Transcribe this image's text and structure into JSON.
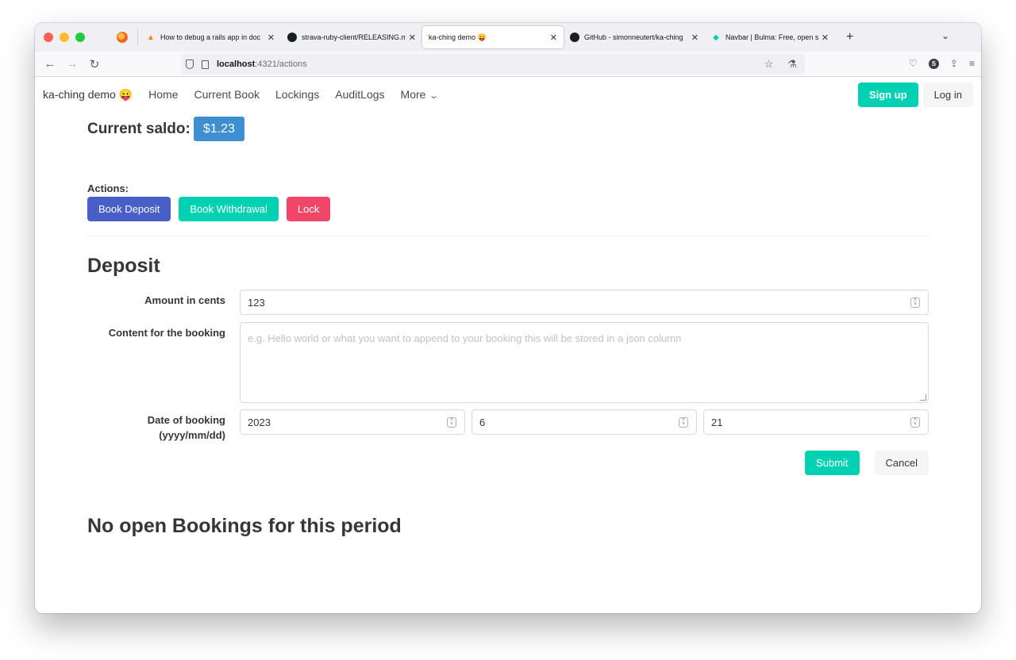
{
  "browser": {
    "tabs": [
      {
        "label": "How to debug a rails app in doc",
        "icon": "stackoverflow-icon"
      },
      {
        "label": "strava-ruby-client/RELEASING.m",
        "icon": "github-icon"
      },
      {
        "label": "ka-ching demo 😛",
        "icon": "",
        "active": true
      },
      {
        "label": "GitHub - simonneutert/ka-ching",
        "icon": "github-icon"
      },
      {
        "label": "Navbar | Bulma: Free, open sour",
        "icon": "bulma-icon"
      }
    ],
    "url_host": "localhost",
    "url_rest": ":4321/actions"
  },
  "site_nav": {
    "brand": "ka-ching demo 😛",
    "items": [
      "Home",
      "Current Book",
      "Lockings",
      "AuditLogs",
      "More"
    ],
    "signup": "Sign up",
    "login": "Log in"
  },
  "saldo": {
    "label": "Current saldo:",
    "value": "$1.23"
  },
  "actions": {
    "label": "Actions:",
    "deposit": "Book Deposit",
    "withdrawal": "Book Withdrawal",
    "lock": "Lock"
  },
  "form": {
    "title": "Deposit",
    "amount_label": "Amount in cents",
    "amount_value": "123",
    "content_label": "Content for the booking",
    "content_placeholder": "e.g. Hello world or what you want to append to your booking this will be stored in a json column",
    "date_label": "Date of booking (yyyy/mm/dd)",
    "year": "2023",
    "month": "6",
    "day": "21",
    "submit": "Submit",
    "cancel": "Cancel"
  },
  "bookings_heading": "No open Bookings for this period",
  "colors": {
    "primary": "#00d1b2",
    "link": "#485fc7",
    "danger": "#f14668",
    "info": "#3e8ed0"
  }
}
